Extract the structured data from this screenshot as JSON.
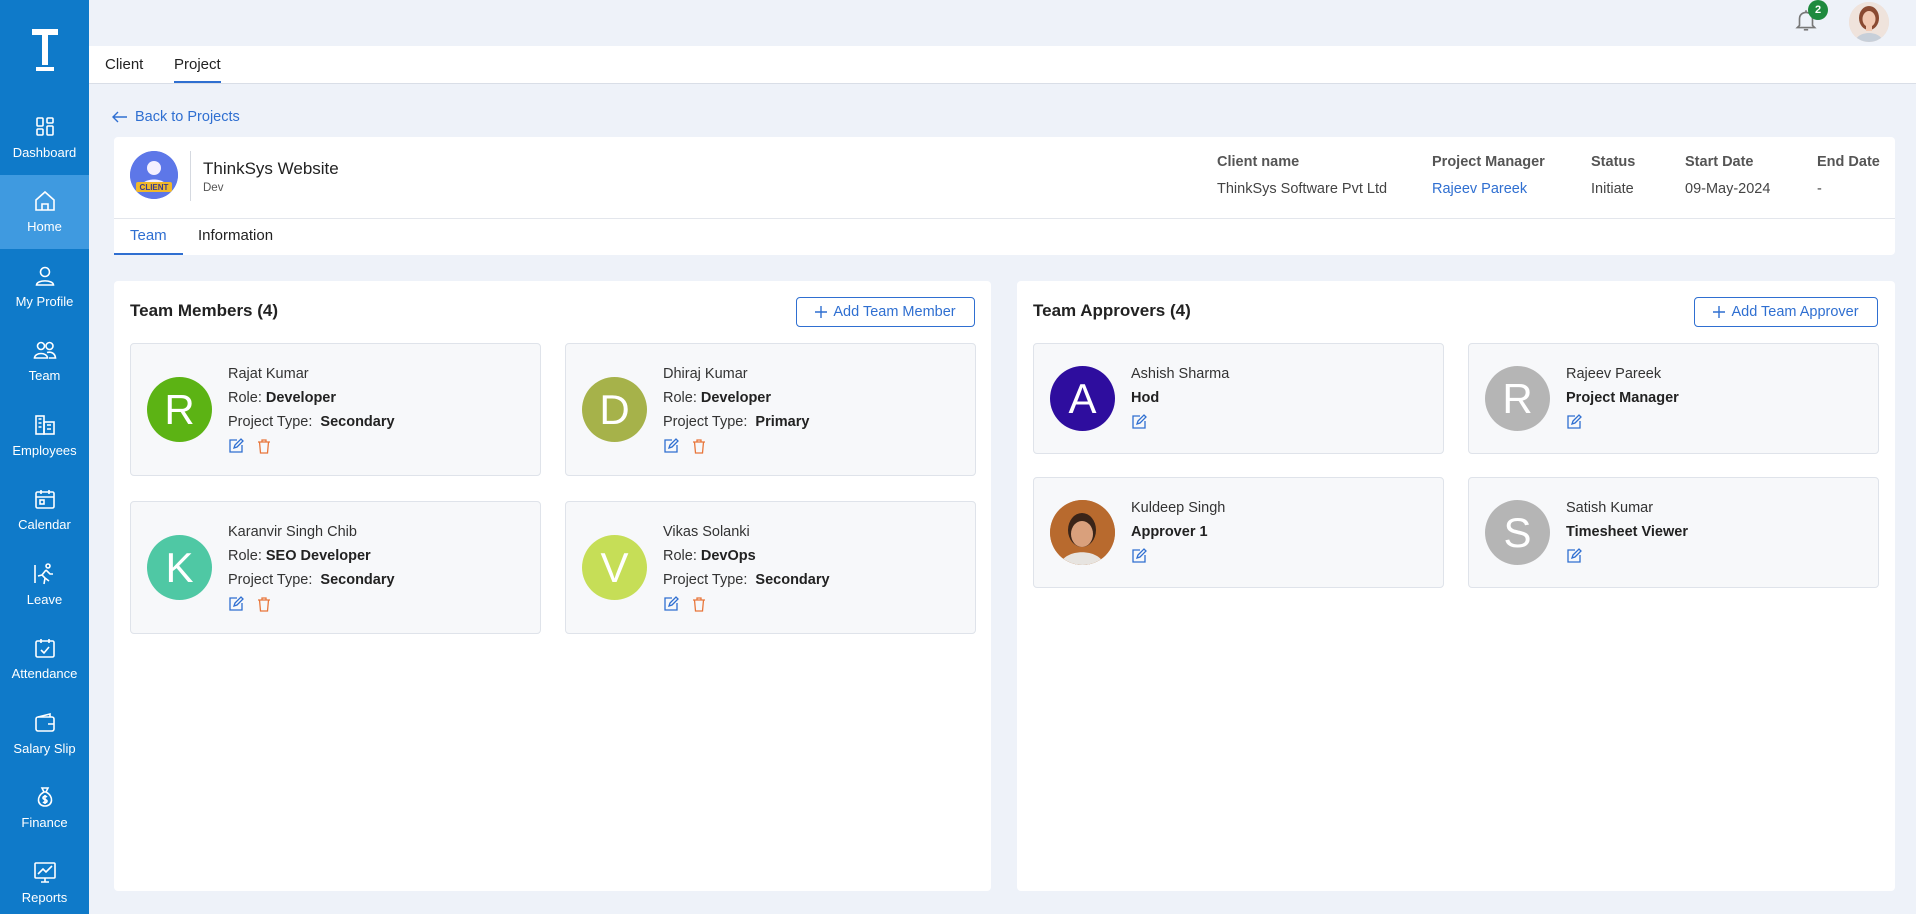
{
  "app": {
    "logo_letter": "T"
  },
  "sidebar": {
    "items": [
      {
        "label": "Dashboard",
        "icon": "dashboard-icon"
      },
      {
        "label": "Home",
        "icon": "home-icon",
        "active": true
      },
      {
        "label": "My Profile",
        "icon": "profile-icon"
      },
      {
        "label": "Team",
        "icon": "team-icon"
      },
      {
        "label": "Employees",
        "icon": "employees-icon"
      },
      {
        "label": "Calendar",
        "icon": "calendar-icon"
      },
      {
        "label": "Leave",
        "icon": "leave-icon"
      },
      {
        "label": "Attendance",
        "icon": "attendance-icon"
      },
      {
        "label": "Salary Slip",
        "icon": "wallet-icon"
      },
      {
        "label": "Finance",
        "icon": "money-bag-icon"
      },
      {
        "label": "Reports",
        "icon": "reports-icon"
      }
    ]
  },
  "topbar": {
    "notification_count": "2"
  },
  "top_tabs": {
    "client": "Client",
    "project": "Project"
  },
  "back_link": "Back to Projects",
  "project": {
    "logo_text": "CLIENT",
    "name": "ThinkSys Website",
    "subtitle": "Dev",
    "meta": {
      "client_label": "Client name",
      "client_value": "ThinkSys Software Pvt Ltd",
      "pm_label": "Project Manager",
      "pm_value": "Rajeev Pareek",
      "status_label": "Status",
      "status_value": "Initiate",
      "start_label": "Start Date",
      "start_value": "09-May-2024",
      "end_label": "End Date",
      "end_value": "-"
    },
    "tabs": {
      "team": "Team",
      "information": "Information"
    }
  },
  "team_members": {
    "title": "Team Members (4)",
    "add_label": "Add Team Member",
    "role_label": "Role:",
    "type_label": "Project Type:",
    "items": [
      {
        "initial": "R",
        "name": "Rajat Kumar",
        "role": "Developer",
        "type": "Secondary"
      },
      {
        "initial": "D",
        "name": "Dhiraj Kumar",
        "role": "Developer",
        "type": "Primary"
      },
      {
        "initial": "K",
        "name": "Karanvir Singh Chib",
        "role": "SEO Developer",
        "type": "Secondary"
      },
      {
        "initial": "V",
        "name": "Vikas Solanki",
        "role": "DevOps",
        "type": "Secondary"
      }
    ]
  },
  "team_approvers": {
    "title": "Team Approvers (4)",
    "add_label": "Add Team Approver",
    "items": [
      {
        "initial": "A",
        "name": "Ashish Sharma",
        "role": "Hod"
      },
      {
        "initial": "R",
        "name": "Rajeev Pareek",
        "role": "Project Manager"
      },
      {
        "initial": "",
        "name": "Kuldeep Singh",
        "role": "Approver 1"
      },
      {
        "initial": "S",
        "name": "Satish Kumar",
        "role": "Timesheet Viewer"
      }
    ]
  },
  "colors": {
    "sidebar": "#0f7ac9",
    "sidebar_active": "#3f9ae0",
    "accent": "#2f6fd1",
    "delete": "#e8763a",
    "avatar_r": "#5cb314",
    "avatar_d": "#a6b24a",
    "avatar_k": "#4fc8a4",
    "avatar_v": "#c6de57",
    "avatar_a": "#2e0d9e",
    "avatar_gray": "#b5b5b5"
  }
}
